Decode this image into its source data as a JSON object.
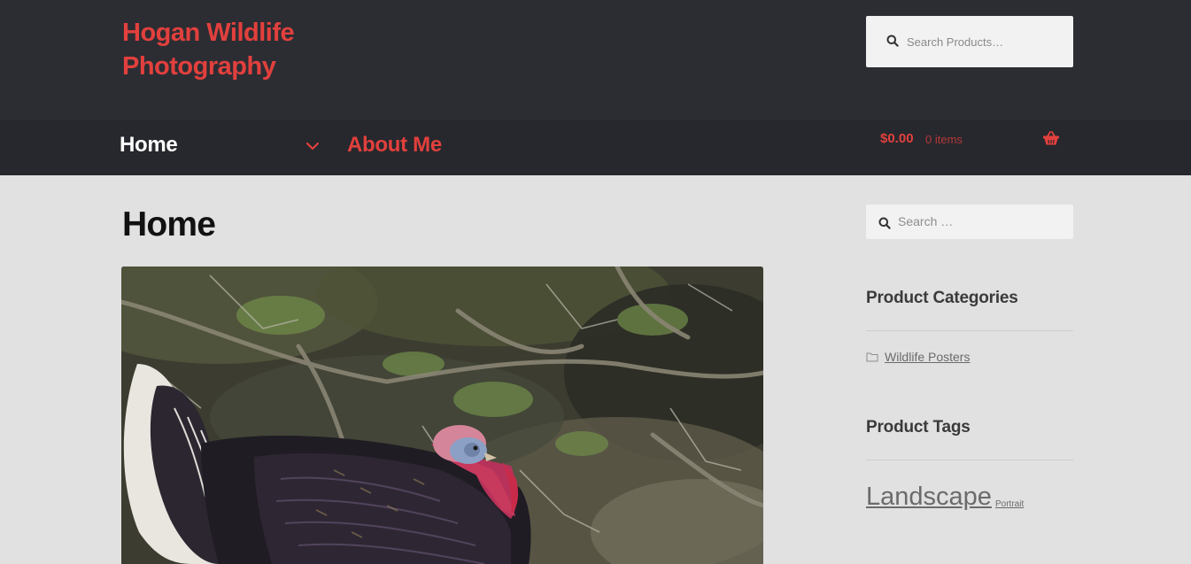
{
  "header": {
    "site_title": "Hogan Wildlife Photography",
    "search_placeholder": "Search Products…"
  },
  "nav": {
    "home_label": "Home",
    "about_label": "About Me"
  },
  "cart": {
    "amount": "$0.00",
    "count": "0 items"
  },
  "page": {
    "title": "Home",
    "hero_image_subject": "wild turkey in brush"
  },
  "sidebar": {
    "search_placeholder": "Search …",
    "categories_title": "Product Categories",
    "categories": [
      {
        "label": "Wildlife Posters"
      }
    ],
    "tags_title": "Product Tags",
    "tags": [
      {
        "label": "Landscape"
      },
      {
        "label": "Portrait"
      }
    ]
  },
  "colors": {
    "header_bg": "#2c2d33",
    "nav_bg": "#27282d",
    "accent": "#e2403d",
    "page_bg": "#e1e1e1"
  }
}
